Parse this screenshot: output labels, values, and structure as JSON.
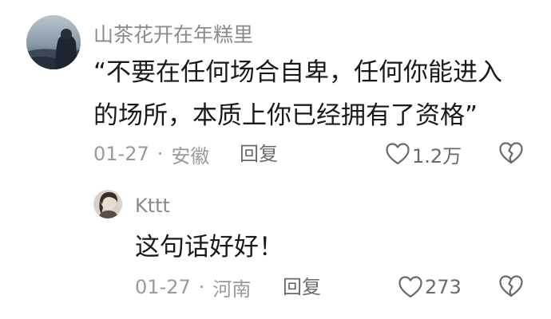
{
  "comments": [
    {
      "username": "山茶花开在年糕里",
      "text_lines": [
        "“不要在任何场合自卑，任何你能进入",
        "的场所，本质上你已经拥有了资格”"
      ],
      "date": "01-27",
      "separator": "·",
      "location": "安徽",
      "reply_label": "回复",
      "like_count": "1.2万"
    },
    {
      "username": "Kttt",
      "text_lines": [
        "这句话好好！"
      ],
      "date": "01-27",
      "separator": "·",
      "location": "河南",
      "reply_label": "回复",
      "like_count": "273"
    }
  ],
  "icons": {
    "like": "heart-outline-icon",
    "dislike": "broken-heart-icon"
  },
  "colors": {
    "text": "#1a1a1a",
    "meta": "#9a9a9a",
    "username": "#8a8a8a"
  }
}
